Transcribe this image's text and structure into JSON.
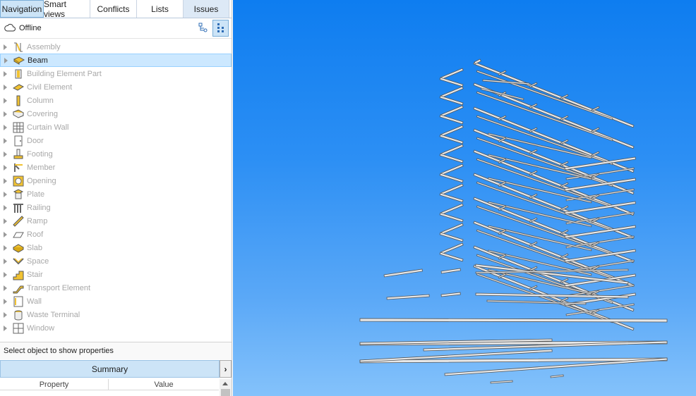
{
  "tabs": [
    {
      "label": "Navigation",
      "active": true
    },
    {
      "label": "Smart views",
      "active": false
    },
    {
      "label": "Conflicts",
      "active": false
    },
    {
      "label": "Lists",
      "active": false
    },
    {
      "label": "Issues",
      "active": false
    }
  ],
  "status": {
    "icon": "cloud-icon",
    "label": "Offline"
  },
  "view_buttons": [
    {
      "icon": "hierarchy-view-icon",
      "active": false
    },
    {
      "icon": "grid-view-icon",
      "active": true
    }
  ],
  "tree": [
    {
      "label": "Assembly",
      "icon": "assembly-icon",
      "selected": false
    },
    {
      "label": "Beam",
      "icon": "beam-icon",
      "selected": true
    },
    {
      "label": "Building Element Part",
      "icon": "building-element-part-icon",
      "selected": false
    },
    {
      "label": "Civil Element",
      "icon": "civil-element-icon",
      "selected": false
    },
    {
      "label": "Column",
      "icon": "column-icon",
      "selected": false
    },
    {
      "label": "Covering",
      "icon": "covering-icon",
      "selected": false
    },
    {
      "label": "Curtain Wall",
      "icon": "curtain-wall-icon",
      "selected": false
    },
    {
      "label": "Door",
      "icon": "door-icon",
      "selected": false
    },
    {
      "label": "Footing",
      "icon": "footing-icon",
      "selected": false
    },
    {
      "label": "Member",
      "icon": "member-icon",
      "selected": false
    },
    {
      "label": "Opening",
      "icon": "opening-icon",
      "selected": false
    },
    {
      "label": "Plate",
      "icon": "plate-icon",
      "selected": false
    },
    {
      "label": "Railing",
      "icon": "railing-icon",
      "selected": false
    },
    {
      "label": "Ramp",
      "icon": "ramp-icon",
      "selected": false
    },
    {
      "label": "Roof",
      "icon": "roof-icon",
      "selected": false
    },
    {
      "label": "Slab",
      "icon": "slab-icon",
      "selected": false
    },
    {
      "label": "Space",
      "icon": "space-icon",
      "selected": false
    },
    {
      "label": "Stair",
      "icon": "stair-icon",
      "selected": false
    },
    {
      "label": "Transport Element",
      "icon": "transport-element-icon",
      "selected": false
    },
    {
      "label": "Wall",
      "icon": "wall-icon",
      "selected": false
    },
    {
      "label": "Waste Terminal",
      "icon": "waste-terminal-icon",
      "selected": false
    },
    {
      "label": "Window",
      "icon": "window-icon",
      "selected": false
    }
  ],
  "properties": {
    "hint": "Select object to show properties",
    "summary_label": "Summary",
    "next_glyph": "›",
    "columns": [
      "Property",
      "Value"
    ]
  },
  "colors": {
    "tab_active": "#cce4f7",
    "selection": "#cce8ff",
    "icon_yellow": "#f1c232",
    "viewport_top": "#0e7df0",
    "viewport_bottom": "#84c2fb",
    "beam_fill": "#e8e8e8",
    "beam_stroke": "#555555"
  }
}
